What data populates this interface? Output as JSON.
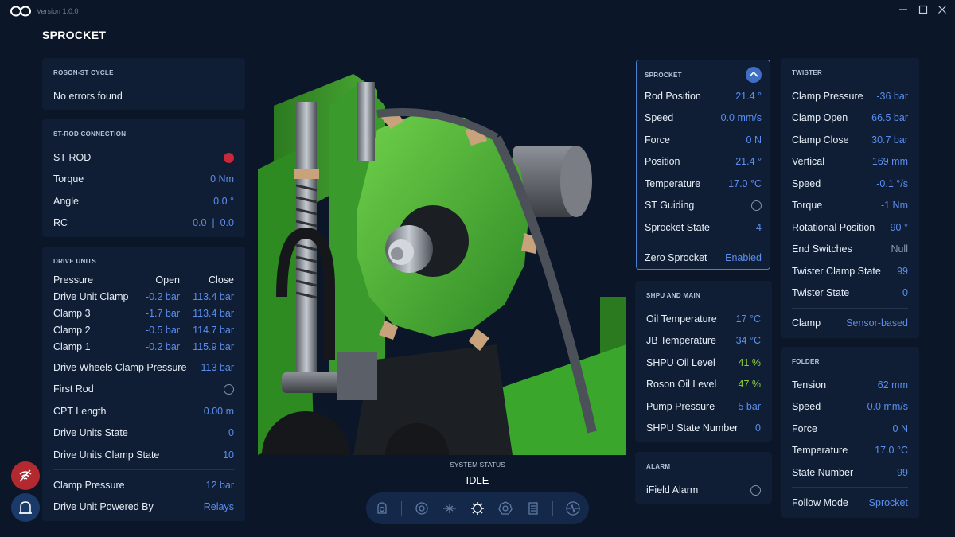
{
  "app": {
    "version": "Version 1.0.0",
    "title": "SPROCKET"
  },
  "window": {
    "minimize": "—",
    "maximize": "☐",
    "close": "✕"
  },
  "roson_cycle": {
    "header": "ROSON-ST CYCLE",
    "message": "No errors found"
  },
  "st_rod": {
    "header": "ST-ROD CONNECTION",
    "rows": [
      {
        "label": "ST-ROD",
        "value": ""
      },
      {
        "label": "Torque",
        "value": "0 Nm"
      },
      {
        "label": "Angle",
        "value": "0.0 °"
      },
      {
        "label": "RC",
        "value": "0.0  |  0.0"
      }
    ]
  },
  "drive_units": {
    "header": "DRIVE UNITS",
    "table_header": {
      "label": "Pressure",
      "open": "Open",
      "close": "Close"
    },
    "table_rows": [
      {
        "label": "Drive Unit Clamp",
        "open": "-0.2 bar",
        "close": "113.4 bar"
      },
      {
        "label": "Clamp 3",
        "open": "-1.7 bar",
        "close": "113.4 bar"
      },
      {
        "label": "Clamp 2",
        "open": "-0.5 bar",
        "close": "114.7 bar"
      },
      {
        "label": "Clamp 1",
        "open": "-0.2 bar",
        "close": "115.9 bar"
      }
    ],
    "rows": [
      {
        "label": "Drive Wheels Clamp Pressure",
        "value": "113 bar"
      },
      {
        "label": "First Rod",
        "value": ""
      },
      {
        "label": "CPT Length",
        "value": "0.00 m"
      },
      {
        "label": "Drive Units State",
        "value": "0"
      },
      {
        "label": "Drive Units Clamp State",
        "value": "10"
      }
    ],
    "footer_rows": [
      {
        "label": "Clamp Pressure",
        "value": "12 bar"
      },
      {
        "label": "Drive Unit Powered By",
        "value": "Relays"
      }
    ]
  },
  "system_status": {
    "label": "SYSTEM STATUS",
    "value": "IDLE"
  },
  "sprocket": {
    "header": "SPROCKET",
    "rows": [
      {
        "label": "Rod Position",
        "value": "21.4 °"
      },
      {
        "label": "Speed",
        "value": "0.0 mm/s"
      },
      {
        "label": "Force",
        "value": "0 N"
      },
      {
        "label": "Position",
        "value": "21.4 °"
      },
      {
        "label": "Temperature",
        "value": "17.0 °C"
      },
      {
        "label": "ST Guiding",
        "value": ""
      },
      {
        "label": "Sprocket State",
        "value": "4"
      }
    ],
    "footer": {
      "label": "Zero Sprocket",
      "value": "Enabled"
    }
  },
  "shpu": {
    "header": "SHPU AND MAIN",
    "rows": [
      {
        "label": "Oil Temperature",
        "value": "17 °C"
      },
      {
        "label": "JB Temperature",
        "value": "34 °C"
      },
      {
        "label": "SHPU Oil Level",
        "value": "41 %"
      },
      {
        "label": "Roson Oil Level",
        "value": "47 %"
      },
      {
        "label": "Pump Pressure",
        "value": "5 bar"
      },
      {
        "label": "SHPU State Number",
        "value": "0"
      }
    ]
  },
  "alarm": {
    "header": "ALARM",
    "label": "iField Alarm"
  },
  "twister": {
    "header": "TWISTER",
    "rows": [
      {
        "label": "Clamp Pressure",
        "value": "-36 bar"
      },
      {
        "label": "Clamp Open",
        "value": "66.5 bar"
      },
      {
        "label": "Clamp Close",
        "value": "30.7 bar"
      },
      {
        "label": "Vertical",
        "value": "169 mm"
      },
      {
        "label": "Speed",
        "value": "-0.1 °/s"
      },
      {
        "label": "Torque",
        "value": "-1 Nm"
      },
      {
        "label": "Rotational Position",
        "value": "90 °"
      },
      {
        "label": "End Switches",
        "value": "Null"
      },
      {
        "label": "Twister Clamp State",
        "value": "99"
      },
      {
        "label": "Twister State",
        "value": "0"
      }
    ],
    "footer": {
      "label": "Clamp",
      "value": "Sensor-based"
    }
  },
  "folder": {
    "header": "FOLDER",
    "rows": [
      {
        "label": "Tension",
        "value": "62 mm"
      },
      {
        "label": "Speed",
        "value": "0.0 mm/s"
      },
      {
        "label": "Force",
        "value": "0 N"
      },
      {
        "label": "Temperature",
        "value": "17.0 °C"
      },
      {
        "label": "State Number",
        "value": "99"
      }
    ],
    "footer": {
      "label": "Follow Mode",
      "value": "Sprocket"
    }
  },
  "colors": {
    "accent": "#5b8ef0",
    "green": "#8fce3f",
    "red": "#c8283a",
    "panel": "#0f1e34",
    "background": "#0b1628"
  }
}
